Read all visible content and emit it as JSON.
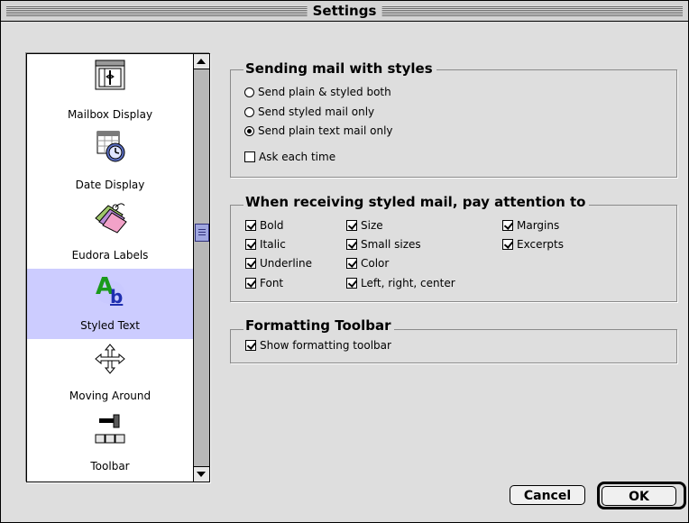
{
  "window": {
    "title": "Settings"
  },
  "sidebar": {
    "items": [
      {
        "label": "Mailbox Display",
        "icon": "mailbox-display-icon"
      },
      {
        "label": "Date Display",
        "icon": "date-display-icon"
      },
      {
        "label": "Eudora Labels",
        "icon": "eudora-labels-icon"
      },
      {
        "label": "Styled Text",
        "icon": "styled-text-icon",
        "selected": true
      },
      {
        "label": "Moving Around",
        "icon": "moving-around-icon"
      },
      {
        "label": "Toolbar",
        "icon": "toolbar-icon"
      }
    ]
  },
  "sending": {
    "title": "Sending mail with styles",
    "options": [
      {
        "label": "Send plain & styled both",
        "selected": false
      },
      {
        "label": "Send styled mail only",
        "selected": false
      },
      {
        "label": "Send plain text mail only",
        "selected": true
      }
    ],
    "ask_each_time": {
      "label": "Ask each time",
      "checked": false
    }
  },
  "receiving": {
    "title": "When receiving styled mail, pay attention to",
    "checkboxes": [
      {
        "label": "Bold",
        "checked": true
      },
      {
        "label": "Italic",
        "checked": true
      },
      {
        "label": "Underline",
        "checked": true
      },
      {
        "label": "Font",
        "checked": true
      },
      {
        "label": "Size",
        "checked": true
      },
      {
        "label": "Small sizes",
        "checked": true
      },
      {
        "label": "Color",
        "checked": true
      },
      {
        "label": "Left, right, center",
        "checked": true
      },
      {
        "label": "Margins",
        "checked": true
      },
      {
        "label": "Excerpts",
        "checked": true
      }
    ]
  },
  "formatting": {
    "title": "Formatting Toolbar",
    "show_toolbar": {
      "label": "Show formatting toolbar",
      "checked": true
    }
  },
  "buttons": {
    "cancel": "Cancel",
    "ok": "OK"
  }
}
